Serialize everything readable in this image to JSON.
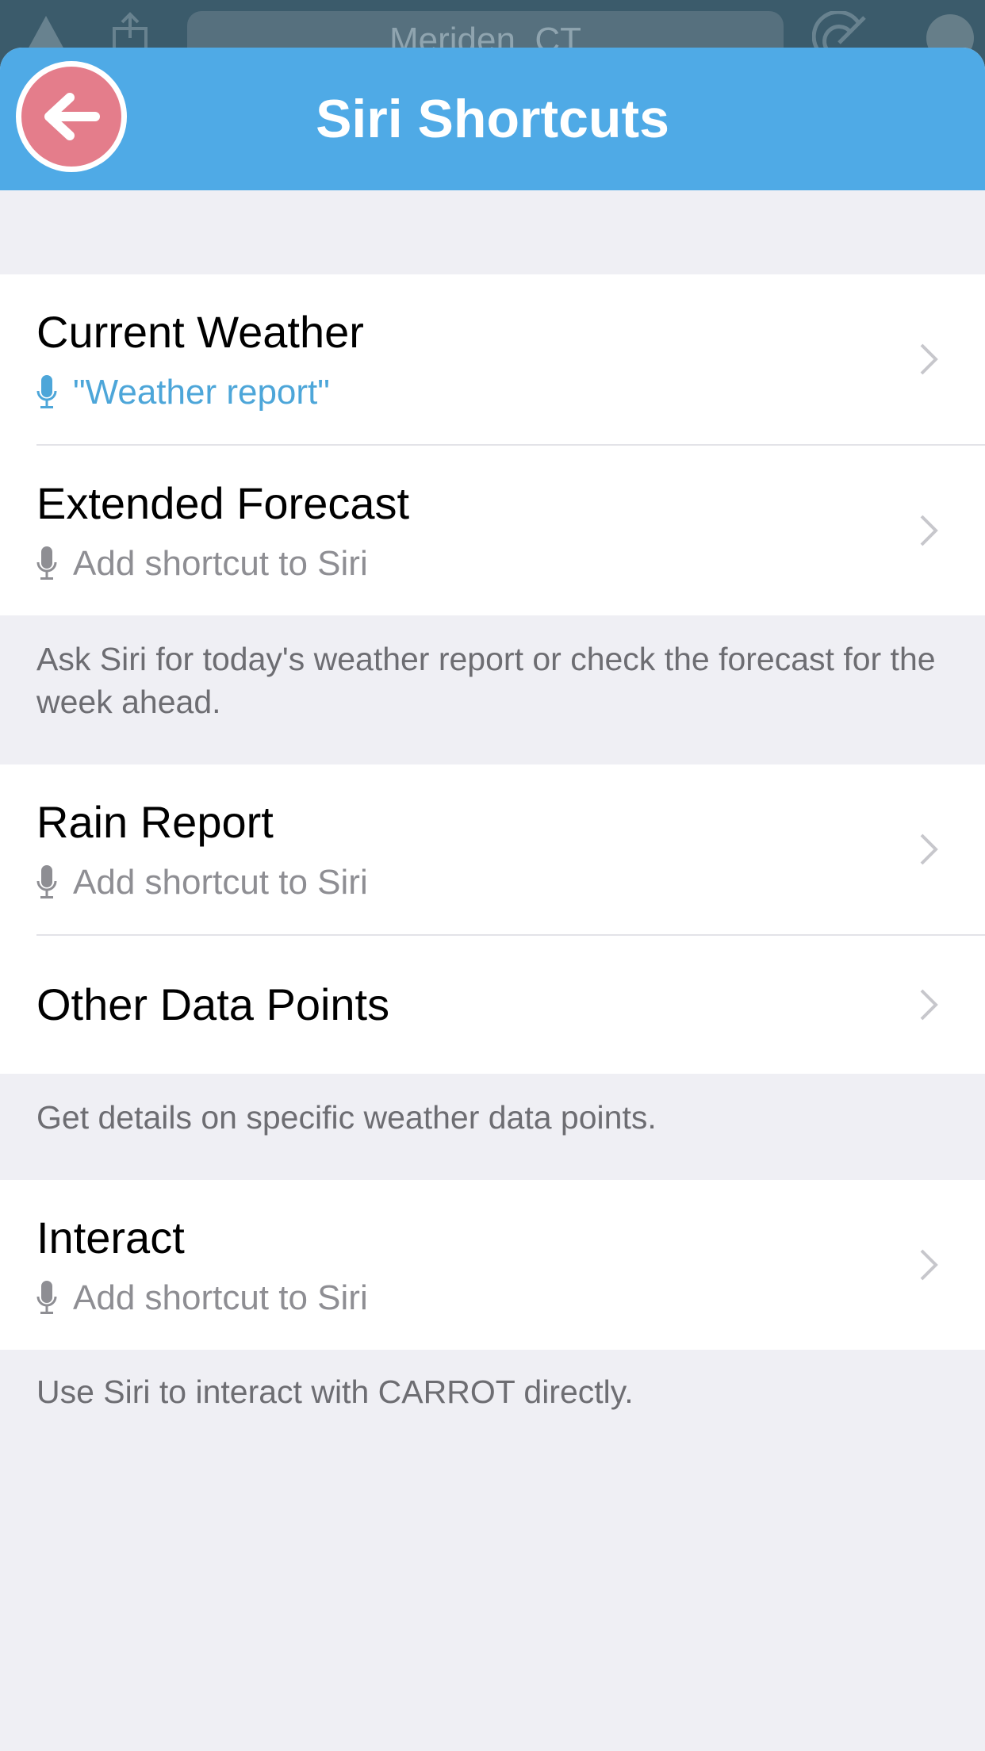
{
  "behind": {
    "location": "Meriden, CT"
  },
  "header": {
    "title": "Siri Shortcuts",
    "back_icon": "back-arrow-icon",
    "colors": {
      "bar": "#4faae6",
      "back_button": "#e47d8b"
    }
  },
  "sections": [
    {
      "rows": [
        {
          "title": "Current Weather",
          "subtitle": "\"Weather report\"",
          "active": true
        },
        {
          "title": "Extended Forecast",
          "subtitle": "Add shortcut to Siri",
          "active": false
        }
      ],
      "footer": "Ask Siri for today's weather report or check the forecast for the week ahead."
    },
    {
      "rows": [
        {
          "title": "Rain Report",
          "subtitle": "Add shortcut to Siri",
          "active": false
        },
        {
          "title": "Other Data Points"
        }
      ],
      "footer": "Get details on specific weather data points."
    },
    {
      "rows": [
        {
          "title": "Interact",
          "subtitle": "Add shortcut to Siri",
          "active": false
        }
      ],
      "footer": "Use Siri to interact with CARROT directly."
    }
  ],
  "colors": {
    "active_shortcut": "#4da6d9",
    "inactive_text": "#8e8e93",
    "background": "#efeff4"
  }
}
